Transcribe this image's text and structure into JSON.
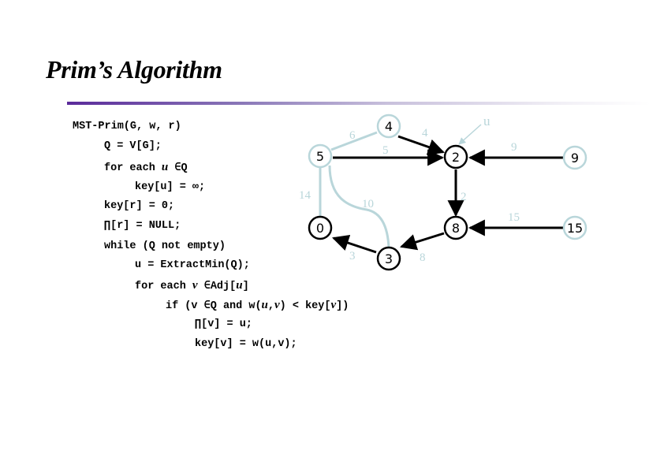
{
  "slide": {
    "title": "Prim’s Algorithm"
  },
  "code": {
    "lines": [
      "MST-Prim(G, w, r)",
      "Q = V[G];",
      "for each ",
      "key[u] = ∞;",
      "key[r] = 0;",
      "∏[r] = NULL;",
      "while (Q not empty)",
      "u = ExtractMin(Q);",
      "for each ",
      "if (v ∈Q and w(",
      "∏[v] = u;",
      "key[v] = w(u,v);"
    ],
    "for_u_var": "u",
    "for_u_rest": " ∈Q",
    "for_v_var": "v",
    "for_v_rest": " ∈Adj[",
    "for_v_u": "u",
    "for_v_close": "]",
    "if_u": "u",
    "if_comma": ",",
    "if_v": "v",
    "if_rest": ") < key[",
    "if_v2": "v",
    "if_close": "])"
  },
  "graph": {
    "colors": {
      "tree_edge": "#000000",
      "nontree_edge": "#b9d6da",
      "visited_node": "#000000",
      "unvisited_node": "#b9d6da"
    },
    "nodes": [
      {
        "id": "n4",
        "label": "4",
        "visited": false
      },
      {
        "id": "n5",
        "label": "5",
        "visited": false
      },
      {
        "id": "n2",
        "label": "2",
        "visited": true
      },
      {
        "id": "n9",
        "label": "9",
        "visited": false
      },
      {
        "id": "n0",
        "label": "0",
        "visited": true
      },
      {
        "id": "n8",
        "label": "8",
        "visited": true
      },
      {
        "id": "n15",
        "label": "15",
        "visited": false
      },
      {
        "id": "n3",
        "label": "3",
        "visited": true
      }
    ],
    "edge_weights": {
      "e5_4": "6",
      "e4_2": "4",
      "e5_2": "5",
      "e9_2": "9",
      "e5_0": "14",
      "e5_3": "10",
      "e2_8": "2",
      "e15_8": "15",
      "e3_0": "3",
      "e8_3": "8"
    },
    "pointer_label": "u"
  }
}
